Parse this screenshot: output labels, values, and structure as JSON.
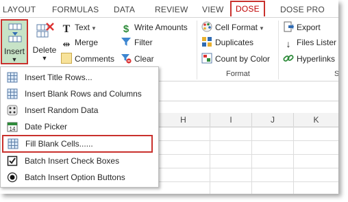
{
  "tabs": [
    "LAYOUT",
    "FORMULAS",
    "DATA",
    "REVIEW",
    "VIEW",
    "DOSE",
    "DOSE PRO"
  ],
  "active_tab": "DOSE",
  "ribbon": {
    "insert_label": "Insert",
    "delete_label": "Delete",
    "text_label": "Text",
    "merge_label": "Merge",
    "comments_label": "Comments",
    "write_amounts_label": "Write Amounts",
    "filter_label": "Filter",
    "clear_label": "Clear",
    "cell_format_label": "Cell Format",
    "duplicates_label": "Duplicates",
    "count_by_color_label": "Count by Color",
    "format_group_label": "Format",
    "export_label": "Export",
    "files_lister_label": "Files Lister",
    "hyperlinks_label": "Hyperlinks",
    "cut_group_label": "S"
  },
  "sheet": {
    "columns": [
      "H",
      "I",
      "J",
      "K"
    ]
  },
  "menu": {
    "items": [
      {
        "label": "Insert Title Rows...",
        "icon": "table-grid-icon"
      },
      {
        "label": "Insert Blank Rows and Columns",
        "icon": "table-grid-icon"
      },
      {
        "label": "Insert Random Data",
        "icon": "dice-icon"
      },
      {
        "label": "Date Picker",
        "icon": "calendar-icon"
      },
      {
        "label": "Fill Blank Cells......",
        "icon": "table-grid-icon"
      },
      {
        "label": "Batch Insert Check Boxes",
        "icon": "checkbox-icon"
      },
      {
        "label": "Batch Insert Option Buttons",
        "icon": "radio-button-icon"
      }
    ],
    "highlighted_index": 4
  },
  "colors": {
    "accent_red": "#c9302c",
    "insert_button_bg": "#c7e3c7"
  }
}
